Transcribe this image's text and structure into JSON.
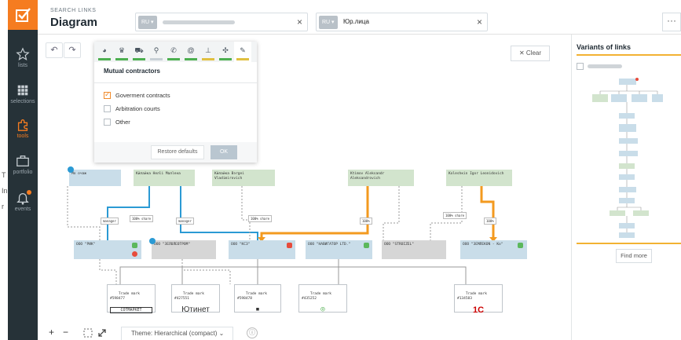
{
  "header": {
    "breadcrumb": "SEARCH LINKS",
    "title": "Diagram",
    "field1": {
      "tag": "RU ▾"
    },
    "field2": {
      "tag": "RU ▾",
      "value": "Юр.лица"
    },
    "clear_glyph": "×",
    "more_glyph": "···"
  },
  "sidebar": {
    "items": [
      {
        "label": "lists",
        "icon": "star-icon"
      },
      {
        "label": "selections",
        "icon": "grid-icon"
      },
      {
        "label": "tools",
        "icon": "puzzle-icon"
      },
      {
        "label": "portfolio",
        "icon": "briefcase-icon"
      },
      {
        "label": "events",
        "icon": "bell-icon"
      }
    ],
    "accent": "#f57c20",
    "bg": "#263238"
  },
  "stray_text": [
    "Т",
    "In",
    "r"
  ],
  "toolbar": {
    "undo": "↶",
    "redo": "↷",
    "clear": "✕ Clear"
  },
  "filter_panel": {
    "tabs": [
      "pie-chart-icon",
      "crown-icon",
      "car-icon",
      "pin-icon",
      "phone-icon",
      "at-icon",
      "stamp-icon",
      "network-icon",
      "tool-icon"
    ],
    "section_title": "Mutual contractors",
    "options": [
      {
        "label": "Goverment contracts",
        "checked": true
      },
      {
        "label": "Arbitration courts",
        "checked": false
      },
      {
        "label": "Other",
        "checked": false
      }
    ],
    "restore_label": "Restore defaults",
    "ok_label": "OK"
  },
  "graph": {
    "people": [
      {
        "name": "Мо очаж"
      },
      {
        "name": "Кйлайка Нелli Малlена"
      },
      {
        "name": "Кйлайка Вэrgei\nVladimirovich"
      },
      {
        "name": "Ktimоv Aleksandr\nAleksandrovich"
      },
      {
        "name": "Кolеshкin Igor Leonidovich"
      }
    ],
    "companies": [
      {
        "name": "ООО \"РИК\""
      },
      {
        "name": "ООО \"ЗЕЛОЛЕОТРОМ\""
      },
      {
        "name": "ООО \"КСЗ\""
      },
      {
        "name": "ООО \"НАВИГАТОР LTD.\""
      },
      {
        "name": "ООО \"STROIZEL\""
      },
      {
        "name": "ООО \"ЗЕМЛЕКОN - Ко\""
      }
    ],
    "edge_labels": [
      "manager",
      "manager",
      "100% share",
      "100% share",
      "100%",
      "100%",
      "100% share"
    ],
    "trademarks": [
      {
        "label": "Trade mark\n#598477",
        "logo": "СОТМАРКЕТ"
      },
      {
        "label": "Trade mark\n#427551",
        "logo": "Ютинет"
      },
      {
        "label": "Trade mark\n#598478",
        "logo": "▪"
      },
      {
        "label": "Trade mark\n#435252",
        "logo": "◎"
      },
      {
        "label": "Trade mark\n#134583",
        "logo": "1С"
      }
    ]
  },
  "bottom_bar": {
    "zoom_in": "+",
    "zoom_out": "−",
    "theme": "Theme: Hierarchical (compact)  ⌄",
    "info": "ⓘ"
  },
  "variants": {
    "title": "Variants of links",
    "find_more": "Find more"
  }
}
